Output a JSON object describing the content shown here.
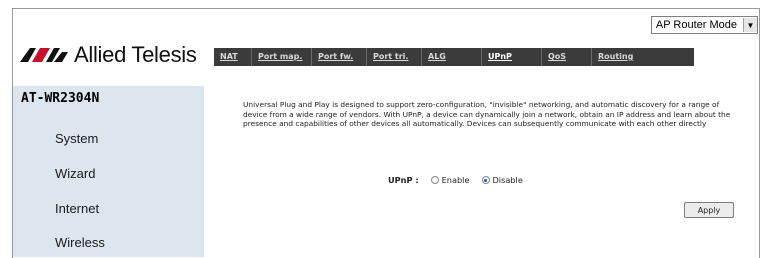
{
  "mode_select": {
    "value": "AP Router Mode"
  },
  "brand": {
    "name": "Allied Telesis"
  },
  "tabs": [
    {
      "label": "NAT",
      "active": false
    },
    {
      "label": "Port map.",
      "active": false
    },
    {
      "label": "Port fw.",
      "active": false
    },
    {
      "label": "Port tri.",
      "active": false
    },
    {
      "label": "ALG",
      "active": false
    },
    {
      "label": "UPnP",
      "active": true
    },
    {
      "label": "QoS",
      "active": false
    },
    {
      "label": "Routing",
      "active": false
    }
  ],
  "sidebar": {
    "model": "AT-WR2304N",
    "items": [
      {
        "label": "System"
      },
      {
        "label": "Wizard"
      },
      {
        "label": "Internet"
      },
      {
        "label": "Wireless"
      }
    ]
  },
  "main": {
    "description": "Universal Plug and Play is designed to support zero-configuration, \"invisible\" networking, and automatic discovery for a range of device from a wide range of vendors. With UPnP, a device can dynamically join a network, obtain an IP address and learn about the presence and capabilities of other devices all automatically. Devices can subsequently communicate with each other directly",
    "upnp": {
      "label": "UPnP :",
      "options": [
        {
          "label": "Enable",
          "selected": false
        },
        {
          "label": "Disable",
          "selected": true
        }
      ]
    },
    "apply_label": "Apply"
  },
  "colors": {
    "tabbar": "#3b3b3b",
    "sidebar": "#dde6ef",
    "brand_red": "#c8102e"
  }
}
